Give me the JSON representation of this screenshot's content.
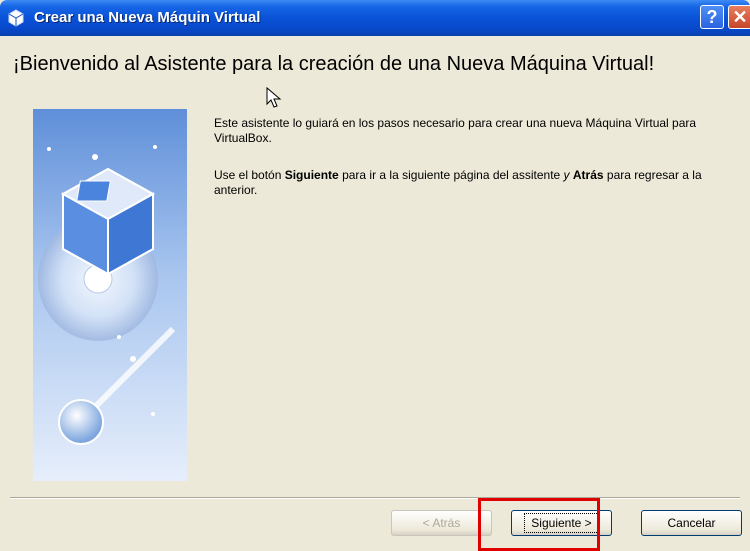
{
  "window": {
    "title": "Crear una Nueva Máquin Virtual",
    "help_label": "?",
    "close_label": "✕"
  },
  "wizard": {
    "heading": "¡Bienvenido al Asistente para la creación de una Nueva Máquina Virtual!",
    "para1": "Este asistente lo guiará en los pasos necesario para crear una nueva Máquina Virtual para VirtualBox.",
    "para2_prefix": "Use el botón ",
    "para2_bold1": "Siguiente",
    "para2_mid": " para ir a la siguiente página del assitente ",
    "para2_italic": "y",
    "para2_space": " ",
    "para2_bold2": "Atrás",
    "para2_suffix": " para regresar a la anterior.",
    "side_image_icon": "virtualbox-logo-icon"
  },
  "buttons": {
    "back_label": "< Atrás",
    "next_label": "Siguiente >",
    "cancel_label": "Cancelar"
  }
}
